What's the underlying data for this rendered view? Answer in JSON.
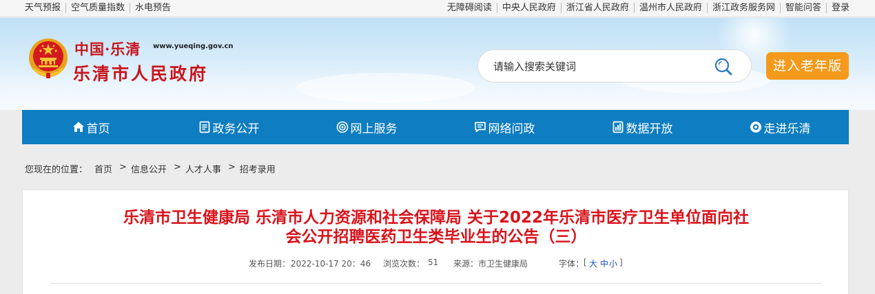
{
  "topbar": {
    "left_links": [
      "天气预报",
      "空气质量指数",
      "水电预告"
    ],
    "right_links": [
      "无障碍阅读",
      "中央人民政府",
      "浙江省人民政府",
      "温州市人民政府",
      "浙江政务服务网",
      "智能问答",
      "登录"
    ]
  },
  "header": {
    "brand_top": "中国·乐清",
    "url": "www.yueqing.gov.cn",
    "title": "乐清市人民政府",
    "search_placeholder": "请输入搜索关键词",
    "elder_button": "进入老年版"
  },
  "nav": {
    "items": [
      {
        "label": "首页",
        "icon": "home-icon"
      },
      {
        "label": "政务公开",
        "icon": "document-icon"
      },
      {
        "label": "网上服务",
        "icon": "service-icon"
      },
      {
        "label": "网络问政",
        "icon": "chat-icon"
      },
      {
        "label": "数据开放",
        "icon": "data-icon"
      },
      {
        "label": "走进乐清",
        "icon": "eye-icon"
      }
    ]
  },
  "breadcrumb": {
    "prefix": "您现在的位置：",
    "items": [
      "首页",
      "信息公开",
      "人才人事",
      "招考录用"
    ],
    "separator": ">"
  },
  "article": {
    "title_line1": "乐清市卫生健康局 乐清市人力资源和社会保障局 关于2022年乐清市医疗卫生单位面向社",
    "title_line2": "会公开招聘医药卫生类毕业生的公告（三）",
    "date_label": "发布日期：",
    "date": "2022-10-17 20：46",
    "views_label": "浏览次数：",
    "views": "51",
    "source_label": "来源：",
    "source": "市卫生健康局",
    "font_label": "字体：",
    "font_open": "[",
    "font_large": "大",
    "font_medium": "中",
    "font_small": "小",
    "font_close": "]"
  },
  "colors": {
    "nav_blue": "#0e7dc1",
    "title_red": "#d8131b",
    "elder_orange": "#f39a1c"
  }
}
